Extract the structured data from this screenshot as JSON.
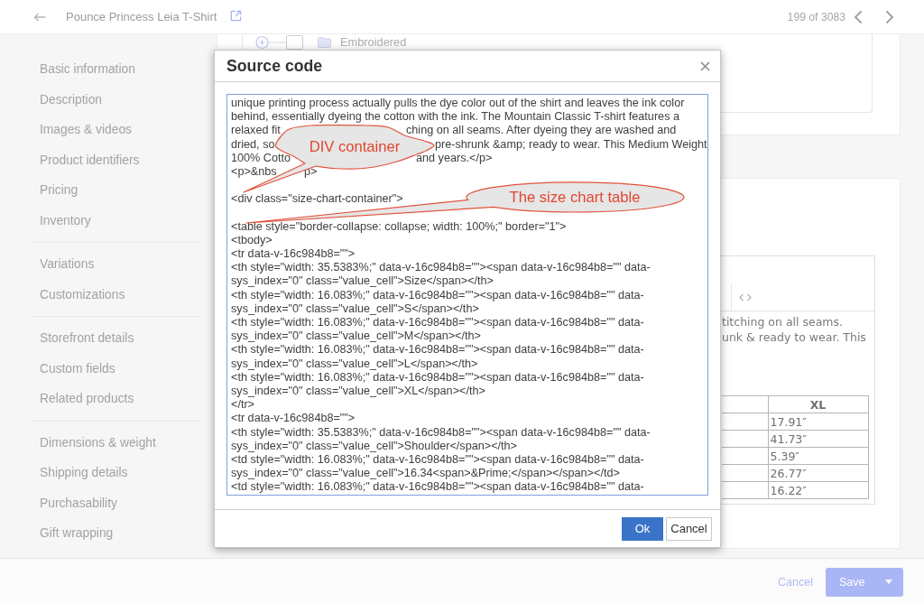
{
  "top_bar": {
    "title": "Pounce Princess Leia T-Shirt",
    "record_counter": "199 of 3083"
  },
  "sidebar": {
    "groups": [
      {
        "items": [
          "Basic information",
          "Description",
          "Images & videos",
          "Product identifiers",
          "Pricing",
          "Inventory"
        ]
      },
      {
        "items": [
          "Variations",
          "Customizations"
        ]
      },
      {
        "items": [
          "Storefront details",
          "Custom fields",
          "Related products"
        ]
      },
      {
        "items": [
          "Dimensions & weight",
          "Shipping details",
          "Purchasability",
          "Gift wrapping"
        ]
      }
    ]
  },
  "option_tree": {
    "rows": [
      {
        "label": "Embroidered",
        "checked": false
      }
    ]
  },
  "description_editor": {
    "text_lines": [
      "titching on all seams.",
      "unk & ready to wear. This"
    ],
    "size_table": {
      "columns": [
        "XL"
      ],
      "rows": [
        [
          "17.91″"
        ],
        [
          "41.73″"
        ],
        [
          "5.39″"
        ],
        [
          "26.77″"
        ],
        [
          "16.22″"
        ]
      ]
    }
  },
  "source_code_dialog": {
    "title": "Source code",
    "code_blocks": [
      [
        [
          "unique printing process actually pulls the dye color out of the shirt and leaves the ink color"
        ],
        [
          "behind, essentially dyeing the cotton with the ink. The Mountain Classic T-shirt features a"
        ],
        [
          "relaxed fit",
          "ching on all seams. After dyeing they are washed and"
        ],
        [
          "dried, so",
          "pre-shrunk &amp; ready to wear. This Medium Weight"
        ],
        [
          "100% Cotto",
          "and years.</p>"
        ],
        [
          "<p>&nbs",
          "p>"
        ]
      ],
      [
        [
          "<div class=\"size-chart-container\">"
        ]
      ],
      [
        [
          "<table style=\"border-collapse: collapse; width: 100%;\" border=\"1\">"
        ],
        [
          "<tbody>"
        ],
        [
          "<tr data-v-16c984b8=\"\">"
        ],
        [
          "<th style=\"width: 35.5383%;\" data-v-16c984b8=\"\"><span data-v-16c984b8=\"\" data-"
        ],
        [
          "sys_index=\"0\" class=\"value_cell\">Size</span></th>"
        ],
        [
          "<th style=\"width: 16.083%;\" data-v-16c984b8=\"\"><span data-v-16c984b8=\"\" data-"
        ],
        [
          "sys_index=\"0\" class=\"value_cell\">S</span></th>"
        ],
        [
          "<th style=\"width: 16.083%;\" data-v-16c984b8=\"\"><span data-v-16c984b8=\"\" data-"
        ],
        [
          "sys_index=\"0\" class=\"value_cell\">M</span></th>"
        ],
        [
          "<th style=\"width: 16.083%;\" data-v-16c984b8=\"\"><span data-v-16c984b8=\"\" data-"
        ],
        [
          "sys_index=\"0\" class=\"value_cell\">L</span></th>"
        ],
        [
          "<th style=\"width: 16.083%;\" data-v-16c984b8=\"\"><span data-v-16c984b8=\"\" data-"
        ],
        [
          "sys_index=\"0\" class=\"value_cell\">XL</span></th>"
        ],
        [
          "</tr>"
        ],
        [
          "<tr data-v-16c984b8=\"\">"
        ],
        [
          "<th style=\"width: 35.5383%;\" data-v-16c984b8=\"\"><span data-v-16c984b8=\"\" data-"
        ],
        [
          "sys_index=\"0\" class=\"value_cell\">Shoulder</span></th>"
        ],
        [
          "<td style=\"width: 16.083%;\" data-v-16c984b8=\"\"><span data-v-16c984b8=\"\" data-"
        ],
        [
          "sys_index=\"0\" class=\"value_cell\">16.34<span>&Prime;</span></span></td>"
        ],
        [
          "<td style=\"width: 16.083%;\" data-v-16c984b8=\"\"><span data-v-16c984b8=\"\" data-"
        ]
      ]
    ],
    "callouts": [
      {
        "text": "DIV container"
      },
      {
        "text": "The size chart table"
      }
    ],
    "buttons": [
      {
        "label": "Ok",
        "kind": "primary"
      },
      {
        "label": "Cancel",
        "kind": "secondary"
      }
    ]
  },
  "footer": {
    "cancel_label": "Cancel",
    "save_label": "Save"
  }
}
